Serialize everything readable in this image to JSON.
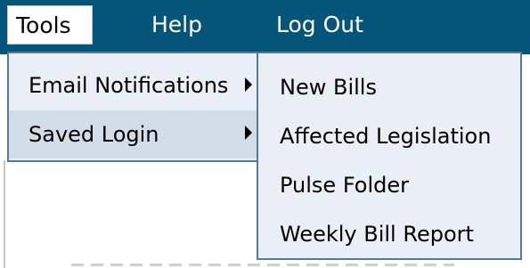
{
  "menubar": {
    "items": [
      {
        "label": "Tools",
        "active": true
      },
      {
        "label": "Help",
        "active": false
      },
      {
        "label": "Log Out",
        "active": false
      }
    ]
  },
  "dropdown": {
    "items": [
      {
        "label": "Email Notifications",
        "has_submenu": true,
        "highlighted": false
      },
      {
        "label": "Saved Login",
        "has_submenu": true,
        "highlighted": true
      }
    ]
  },
  "submenu": {
    "items": [
      {
        "label": "New Bills"
      },
      {
        "label": "Affected Legislation"
      },
      {
        "label": "Pulse Folder"
      },
      {
        "label": "Weekly Bill Report"
      }
    ]
  },
  "colors": {
    "menubar_bg": "#045579",
    "menu_bg": "#e9eff4",
    "menu_border": "#4f7c9c",
    "highlight": "#d2dde7",
    "active_tab_bg": "#ffffff"
  }
}
